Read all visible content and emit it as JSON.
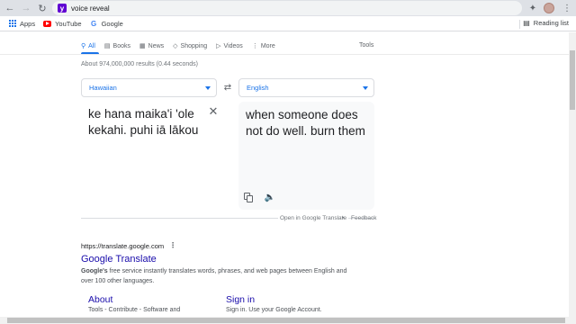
{
  "browser": {
    "omnibox_text": "voice reveal",
    "bookmarks": [
      {
        "label": "Apps",
        "icon": "apps-icon"
      },
      {
        "label": "YouTube",
        "icon": "youtube-icon"
      },
      {
        "label": "Google",
        "icon": "google-icon"
      }
    ],
    "reading_list": "Reading list"
  },
  "search": {
    "tabs": [
      {
        "label": "All",
        "icon": "search-icon"
      },
      {
        "label": "Books",
        "icon": "book-icon"
      },
      {
        "label": "News",
        "icon": "news-icon"
      },
      {
        "label": "Shopping",
        "icon": "tag-icon"
      },
      {
        "label": "Videos",
        "icon": "video-icon"
      },
      {
        "label": "More",
        "icon": "more-icon"
      }
    ],
    "tools": "Tools",
    "result_stats": "About 974,000,000 results (0.44 seconds)"
  },
  "translate": {
    "source_lang": "Hawaiian",
    "target_lang": "English",
    "source_text": "ke hana maika'i 'ole kekahi. puhi iā lākou",
    "output_text": "when someone does not do well. burn them",
    "open_link": "Open in Google Translate",
    "separator": "•",
    "feedback": "Feedback"
  },
  "result": {
    "url": "https://translate.google.com",
    "title": "Google Translate",
    "snippet_bold": "Google's",
    "snippet_rest": " free service instantly translates words, phrases, and web pages between English and over 100 other languages.",
    "sublinks": [
      {
        "title": "About",
        "desc": "Tools - Contribute - Software and"
      },
      {
        "title": "Sign in",
        "desc": "Sign in. Use your Google Account."
      }
    ]
  },
  "colors": {
    "accent": "#1a73e8",
    "link": "#1a0dab",
    "chrome": "#dee1e6"
  }
}
